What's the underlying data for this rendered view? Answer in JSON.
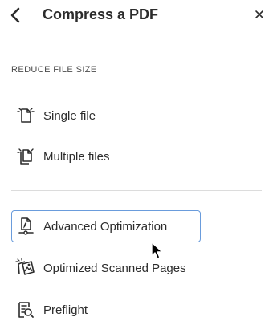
{
  "header": {
    "title": "Compress a PDF",
    "back_icon": "chevron-left-icon",
    "close_icon": "close-icon"
  },
  "reduce": {
    "section_label": "REDUCE FILE SIZE",
    "items": [
      {
        "label": "Single file",
        "icon": "single-file-icon"
      },
      {
        "label": "Multiple files",
        "icon": "multiple-files-icon"
      }
    ]
  },
  "tools": {
    "items": [
      {
        "label": "Advanced Optimization",
        "icon": "advanced-optimization-icon",
        "selected": true
      },
      {
        "label": "Optimized Scanned Pages",
        "icon": "scanned-pages-icon"
      },
      {
        "label": "Preflight",
        "icon": "preflight-icon"
      }
    ]
  },
  "colors": {
    "selection_border": "#6a9cdc",
    "text": "#2c2c2c"
  }
}
